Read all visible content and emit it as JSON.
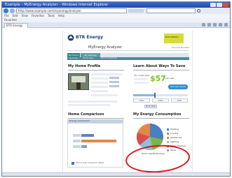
{
  "browser": {
    "title": "Example – MyEnergy Analyzer – Windows Internet Explorer",
    "address": "http://www.example.com/myenergy/analyzer",
    "menu": [
      "File",
      "Edit",
      "View",
      "Favorites",
      "Tools",
      "Help"
    ],
    "favorites_label": "Favorites",
    "tab_label": "BTR Energy"
  },
  "site": {
    "brand": "BTR Energy",
    "sponsor": "BTR ENERGY",
    "app_title": "MyEnergy Analyzer",
    "account_label": "Account Number",
    "nav_tabs": [
      "My Home",
      "My Savings"
    ],
    "subnav": [
      "My Home",
      "Tips & Ideas",
      "Home Comparison"
    ],
    "profile": {
      "title": "My Home Profile"
    },
    "savings": {
      "title": "Learn About Ways To Save",
      "lead": "You could save",
      "amount": "$57",
      "unit": "per year",
      "button": "Get Your Score",
      "scale": [
        "10%",
        "20%",
        "30%"
      ],
      "more": "More Ideas"
    },
    "comparison": {
      "title": "Home Comparison",
      "tab": "Energy Comparison",
      "note": "Click to view comparison details"
    },
    "consumption": {
      "title": "My Energy Consumption",
      "caption": "Home Use Breakdown",
      "legend": [
        "Heating",
        "Cooling",
        "Appliances",
        "Lighting",
        "Water Heating",
        "Other"
      ]
    }
  },
  "colors": {
    "accent_green": "#7cc31e",
    "nav_teal": "#3c7f8a",
    "highlight_red": "#e0161b"
  }
}
